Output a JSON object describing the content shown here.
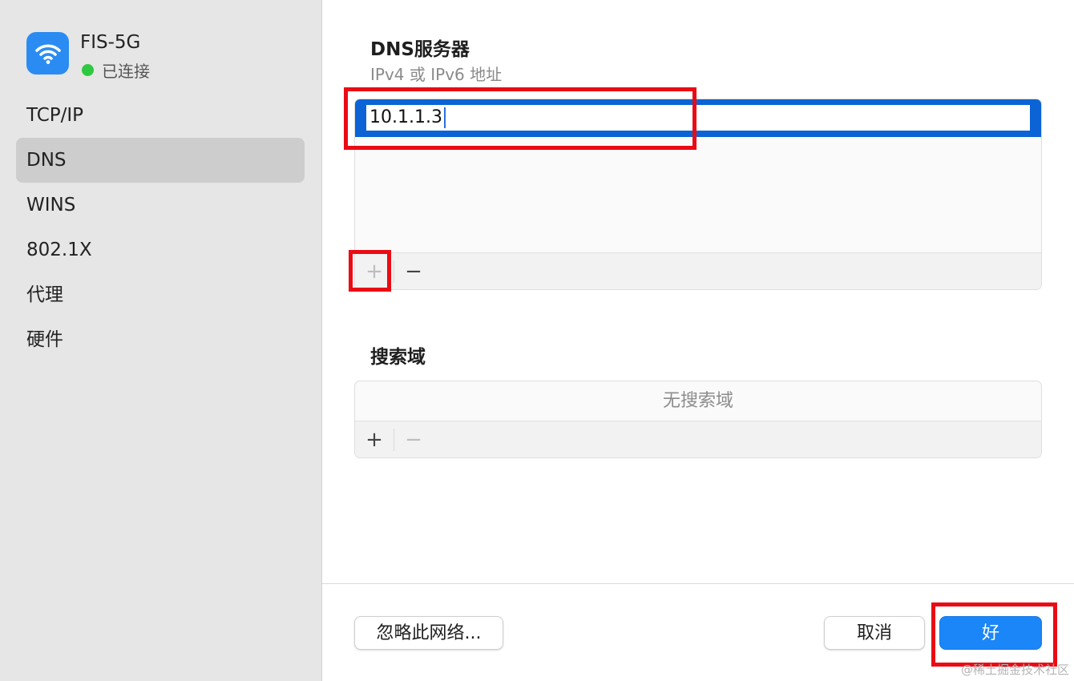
{
  "sidebar": {
    "network_name": "FIS-5G",
    "network_status": "已连接",
    "items": [
      {
        "label": "TCP/IP"
      },
      {
        "label": "DNS"
      },
      {
        "label": "WINS"
      },
      {
        "label": "802.1X"
      },
      {
        "label": "代理"
      },
      {
        "label": "硬件"
      }
    ],
    "active_item": "DNS"
  },
  "dns": {
    "title": "DNS服务器",
    "subtitle": "IPv4 或 IPv6 地址",
    "servers": [
      "10.1.1.3"
    ],
    "add_symbol": "+",
    "remove_symbol": "−"
  },
  "search_domains": {
    "title": "搜索域",
    "empty_text": "无搜索域",
    "add_symbol": "+",
    "remove_symbol": "−"
  },
  "footer": {
    "forget_label": "忽略此网络...",
    "cancel_label": "取消",
    "ok_label": "好"
  },
  "watermark": "@稀土掘金技术社区",
  "colors": {
    "accent": "#1b86f7",
    "selection": "#0b63d5",
    "highlight_box": "#ea0b14",
    "status_connected": "#2ec940"
  }
}
